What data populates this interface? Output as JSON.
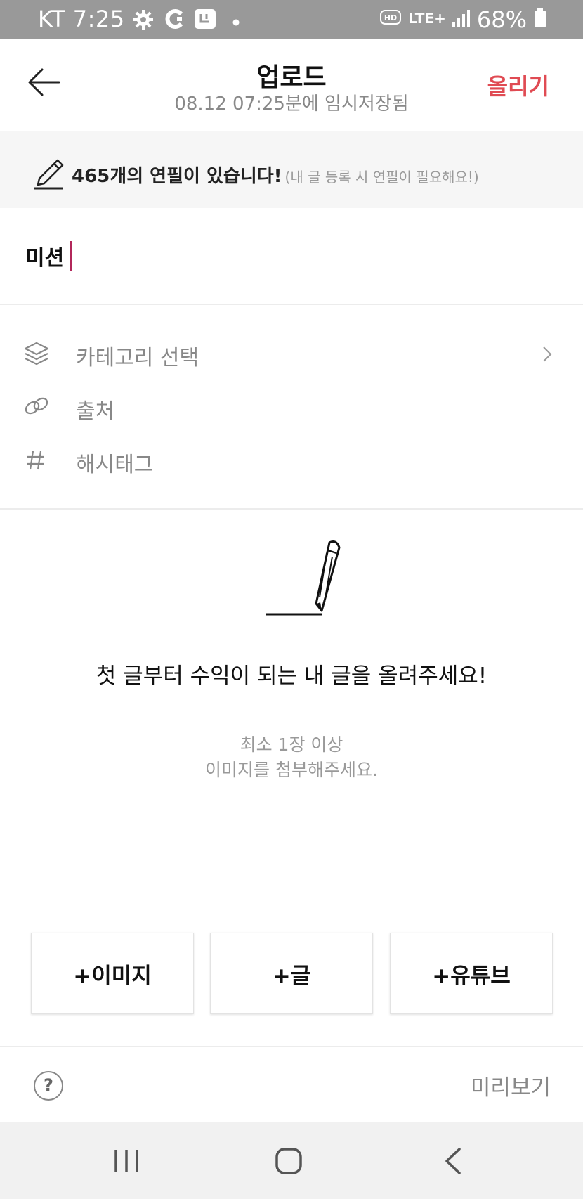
{
  "status_bar": {
    "carrier_time": "KT 7:25",
    "network": "LTE+",
    "battery": "68%",
    "icons": [
      "settings-gear-icon",
      "app-icon",
      "app-icon",
      "dot-icon",
      "hd-icon",
      "lte-icon",
      "signal-icon",
      "battery-icon"
    ]
  },
  "header": {
    "title": "업로드",
    "subtitle": "08.12 07:25분에 임시저장됨",
    "upload_label": "올리기",
    "accent_color": "#e04b53"
  },
  "banner": {
    "count_text": "465개의 연필이 있습니다!",
    "note": "(내 글 등록 시 연필이 필요해요!)"
  },
  "title_input": {
    "value": "미션",
    "caret_color": "#b2275a"
  },
  "options": [
    {
      "label": "카테고리 선택",
      "icon": "layers-icon",
      "has_chevron": true
    },
    {
      "label": "출처",
      "icon": "link-icon",
      "has_chevron": false
    },
    {
      "label": "해시태그",
      "icon": "hashtag-icon",
      "has_chevron": false
    }
  ],
  "empty_state": {
    "message": "첫 글부터 수익이 되는 내 글을 올려주세요!",
    "hint_line1": "최소 1장 이상",
    "hint_line2": "이미지를 첨부해주세요."
  },
  "add_buttons": {
    "image": "+이미지",
    "text": "+글",
    "youtube": "+유튜브"
  },
  "footer": {
    "help": "?",
    "preview": "미리보기"
  }
}
